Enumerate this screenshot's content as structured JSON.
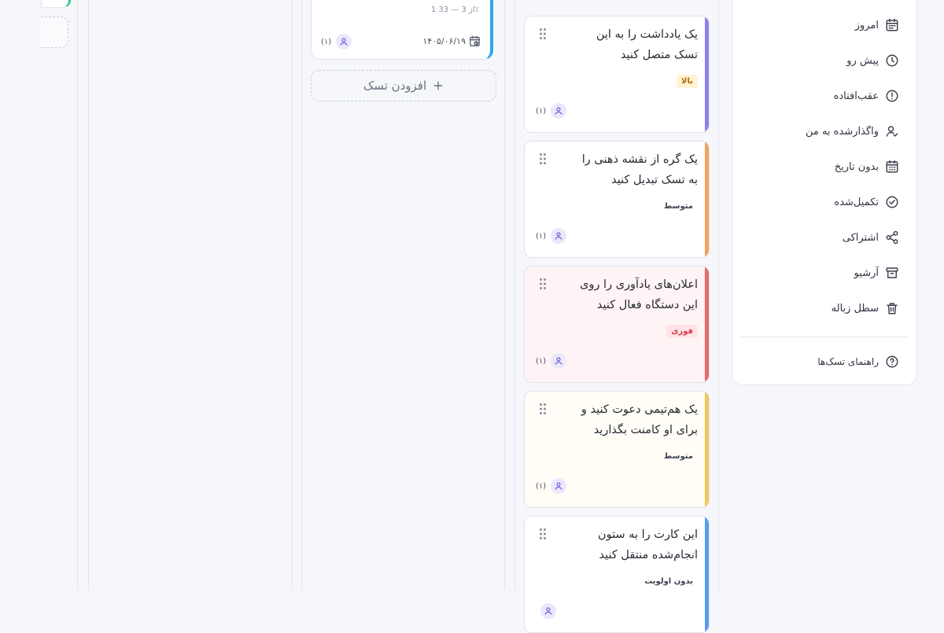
{
  "colors": {
    "card_accents": [
      "#8f7ff0",
      "#f4a25c",
      "#e86a6a",
      "#f0c75a",
      "#5a9cf0"
    ],
    "card_bgs": [
      "#ffffff",
      "#ffffff",
      "#fff4f5",
      "#fffdf6",
      "#ffffff"
    ],
    "mid_card_accent": "#2fa8e8"
  },
  "mid_card": {
    "progress": "1 از 3 — 33٪",
    "due_date": "۱۴۰۵/۰۶/۱۹",
    "assignee_count": "(۱)"
  },
  "add_task": {
    "label": "افزودن تسک",
    "icon": "plus-icon"
  },
  "tasks": [
    {
      "title": "یک یادداشت را به این تسک متصل کنید",
      "priority": "بالا",
      "priority_color": "#b36b00",
      "priority_bg": "#fff3d6",
      "assignee_count": "(۱)"
    },
    {
      "title": "یک گره از نقشه ذهنی را به تسک تبدیل کنید",
      "priority": "متوسط",
      "priority_color": "#3e4350",
      "priority_bg": "transparent",
      "assignee_count": "(۱)"
    },
    {
      "title": "اعلان‌های یادآوری را روی این دستگاه فعال کنید",
      "priority": "فوری",
      "priority_color": "#d23b4a",
      "priority_bg": "#ffe3e6",
      "assignee_count": "(۱)"
    },
    {
      "title": "یک هم‌تیمی دعوت کنید و برای او کامنت بگذارید",
      "priority": "متوسط",
      "priority_color": "#3e4350",
      "priority_bg": "transparent",
      "assignee_count": "(۱)"
    },
    {
      "title": "این کارت را به ستون انجام‌شده منتقل کنید",
      "priority": "بدون اولویت",
      "priority_color": "#3e4350",
      "priority_bg": "transparent",
      "assignee_count": ""
    }
  ],
  "sidebar": {
    "items": [
      {
        "label": "امروز",
        "icon": "calendar-icon"
      },
      {
        "label": "پیش رو",
        "icon": "clock-icon"
      },
      {
        "label": "عقب‌افتاده",
        "icon": "alert-circle-icon"
      },
      {
        "label": "واگذارشده به من",
        "icon": "user-check-icon"
      },
      {
        "label": "بدون تاریخ",
        "icon": "calendar-grid-icon"
      },
      {
        "label": "تکمیل‌شده",
        "icon": "check-circle-icon"
      },
      {
        "label": "اشتراکی",
        "icon": "share-icon"
      },
      {
        "label": "آرشیو",
        "icon": "archive-icon"
      },
      {
        "label": "سطل زباله",
        "icon": "trash-icon"
      }
    ],
    "help": {
      "label": "راهنمای تسک‌ها",
      "icon": "help-circle-icon"
    }
  }
}
